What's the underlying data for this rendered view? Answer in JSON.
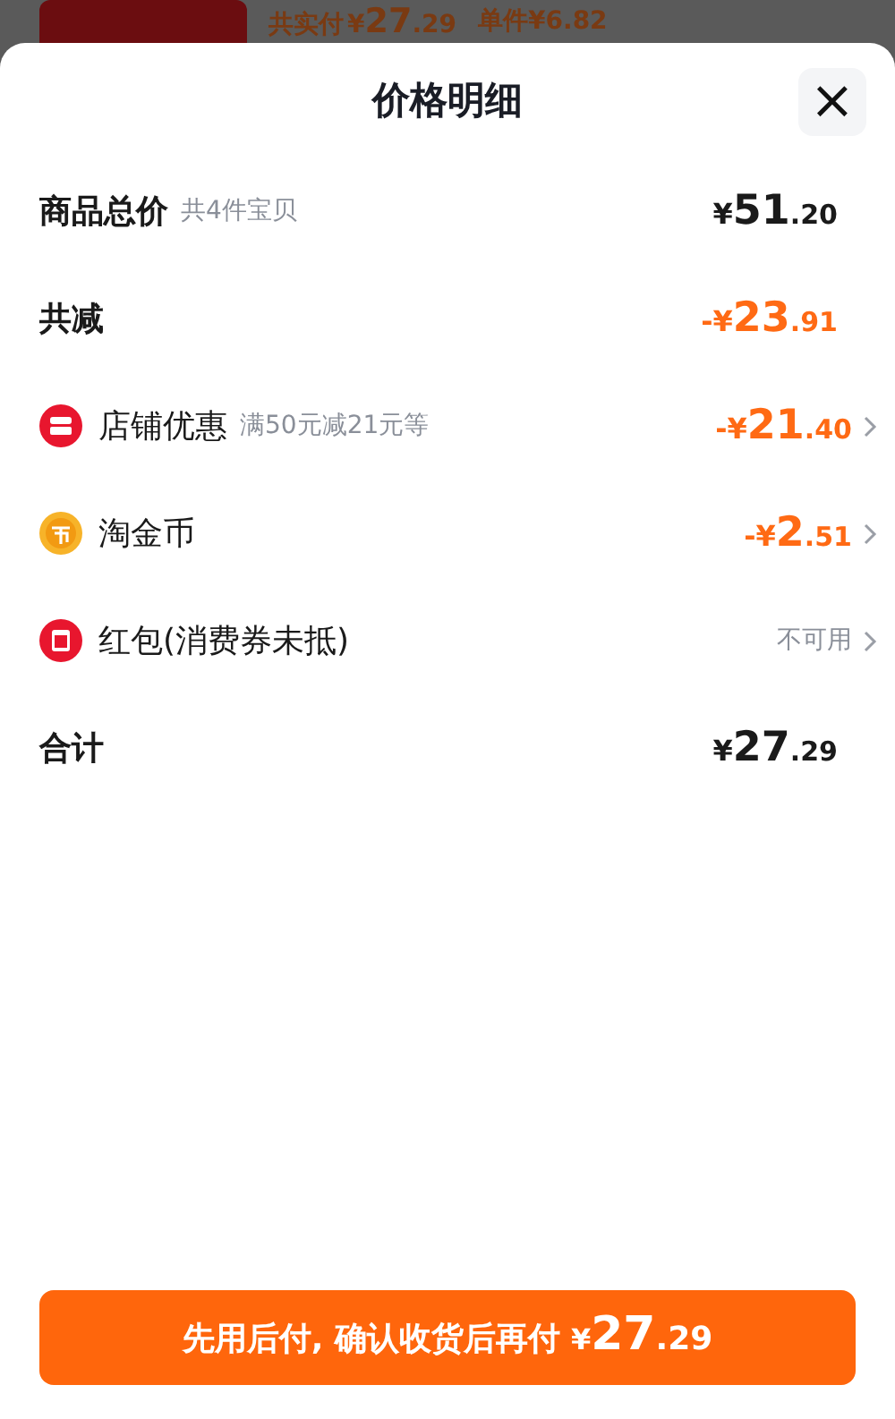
{
  "background": {
    "paid_label": "共实付",
    "paid_amount": {
      "prefix": "¥",
      "integer": "27",
      "decimal": ".29"
    },
    "unit_price": "单件¥6.82"
  },
  "sheet": {
    "title": "价格明细",
    "close": "×"
  },
  "rows": [
    {
      "kind": "subtotal",
      "label": "商品总价",
      "note": "共4件宝贝",
      "amount": {
        "prefix": "¥",
        "integer": "51",
        "decimal": ".20"
      },
      "chevron": false
    },
    {
      "kind": "reduction",
      "label": "共减",
      "amount": {
        "prefix": "-¥",
        "integer": "23",
        "decimal": ".91"
      },
      "chevron": false
    },
    {
      "kind": "shop",
      "label": "店铺优惠",
      "note": "满50元减21元等",
      "amount": {
        "prefix": "-¥",
        "integer": "21",
        "decimal": ".40"
      },
      "chevron": true
    },
    {
      "kind": "coin",
      "label": "淘金币",
      "amount": {
        "prefix": "-¥",
        "integer": "2",
        "decimal": ".51"
      },
      "chevron": true
    },
    {
      "kind": "packet",
      "label": "红包(消费券未抵)",
      "status": "不可用",
      "chevron": true
    },
    {
      "kind": "total",
      "label": "合计",
      "amount": {
        "prefix": "¥",
        "integer": "27",
        "decimal": ".29"
      },
      "chevron": false
    }
  ],
  "pay_button": {
    "label": "先用后付, 确认收货后再付",
    "amount": {
      "prefix": "¥",
      "integer": "27",
      "decimal": ".29"
    }
  }
}
